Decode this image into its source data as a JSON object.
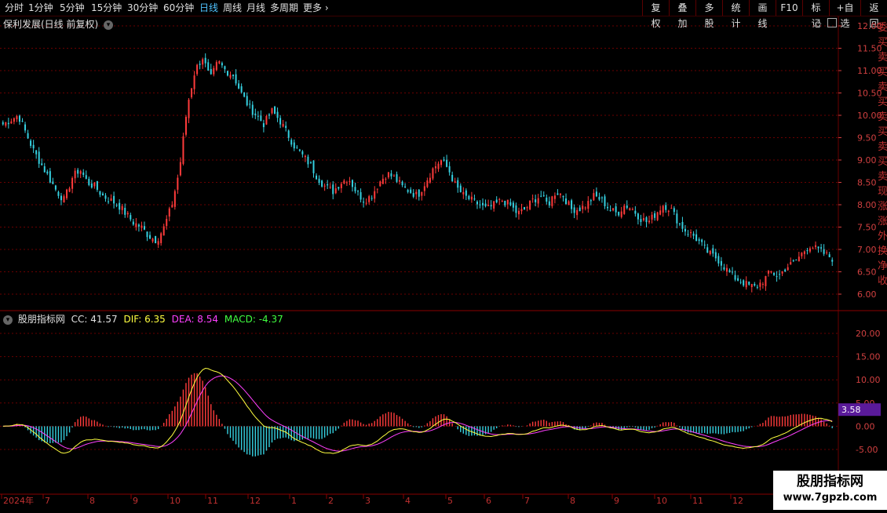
{
  "toolbar": {
    "periods": [
      {
        "label": "分时",
        "active": false
      },
      {
        "label": "1分钟",
        "active": false
      },
      {
        "label": "5分钟",
        "active": false
      },
      {
        "label": "15分钟",
        "active": false
      },
      {
        "label": "30分钟",
        "active": false
      },
      {
        "label": "60分钟",
        "active": false
      },
      {
        "label": "日线",
        "active": true
      },
      {
        "label": "周线",
        "active": false
      },
      {
        "label": "月线",
        "active": false
      },
      {
        "label": "多周期",
        "active": false
      },
      {
        "label": "更多",
        "active": false
      }
    ],
    "right_buttons": [
      "复权",
      "叠加",
      "多股",
      "统计",
      "画线",
      "F10",
      "标记",
      "+自选",
      "返回"
    ]
  },
  "main_panel": {
    "title": "保利发展(日线 前复权)",
    "y_ticks": [
      "12.00",
      "11.50",
      "11.00",
      "10.50",
      "10.00",
      "9.50",
      "9.00",
      "8.50",
      "8.00",
      "7.50",
      "7.00",
      "6.50",
      "6.00"
    ]
  },
  "indicator_panel": {
    "name": "股朋指标网",
    "cc_label": "CC: 41.57",
    "dif_label": "DIF: 6.35",
    "dea_label": "DEA: 8.54",
    "macd_label": "MACD: -4.37",
    "y_ticks": [
      "20.00",
      "15.00",
      "10.00",
      "5.00",
      "0.00",
      "-5.00"
    ],
    "current_value": "3.58"
  },
  "x_axis": {
    "labels": [
      "2024年",
      "7",
      "8",
      "9",
      "10",
      "11",
      "12",
      "1",
      "2",
      "3",
      "4",
      "5",
      "6",
      "7",
      "8",
      "9",
      "10",
      "11",
      "12"
    ]
  },
  "watermark": {
    "line1": "股朋指标网",
    "line2": "www.7gpzb.com"
  },
  "right_strip_text": [
    "委",
    "买",
    "卖",
    "买",
    "卖",
    "买",
    "卖",
    "买",
    "卖",
    "买",
    "卖",
    "现",
    "涨",
    "涨",
    "外",
    "换",
    "净",
    "收"
  ],
  "colors": {
    "up": "#ff3b3b",
    "down": "#35d0e0",
    "dif": "#ffff40",
    "dea": "#ff40ff",
    "macd": "#40ff40",
    "grid": "#6a0000"
  },
  "chart_data": {
    "type": "candlestick",
    "price_range": [
      6.0,
      12.2
    ],
    "macd_range": [
      -7.5,
      22
    ],
    "close_path": [
      9.8,
      9.9,
      10.0,
      9.6,
      9.2,
      8.9,
      8.6,
      8.3,
      8.1,
      8.6,
      8.8,
      8.5,
      8.4,
      8.2,
      8.1,
      8.0,
      7.8,
      7.6,
      7.5,
      7.3,
      7.2,
      7.5,
      8.0,
      8.8,
      10.2,
      11.0,
      11.3,
      10.8,
      11.2,
      11.0,
      10.9,
      10.5,
      10.2,
      10.0,
      9.8,
      10.1,
      9.9,
      9.6,
      9.3,
      9.1,
      8.9,
      8.6,
      8.4,
      8.3,
      8.5,
      8.6,
      8.3,
      8.1,
      8.2,
      8.5,
      8.7,
      8.6,
      8.4,
      8.3,
      8.2,
      8.5,
      8.8,
      9.0,
      8.8,
      8.4,
      8.2,
      8.1,
      8.0,
      7.9,
      8.0,
      8.1,
      8.0,
      7.8,
      7.9,
      8.1,
      8.2,
      8.0,
      8.3,
      8.2,
      7.9,
      7.9,
      8.0,
      8.2,
      8.1,
      7.9,
      7.8,
      8.0,
      7.9,
      7.7,
      7.6,
      7.8,
      8.0,
      7.9,
      7.6,
      7.4,
      7.3,
      7.1,
      6.9,
      6.8,
      6.6,
      6.4,
      6.3,
      6.2,
      6.15,
      6.3,
      6.5,
      6.4,
      6.6,
      6.7,
      6.9,
      7.1,
      7.0,
      6.9,
      6.8
    ]
  }
}
